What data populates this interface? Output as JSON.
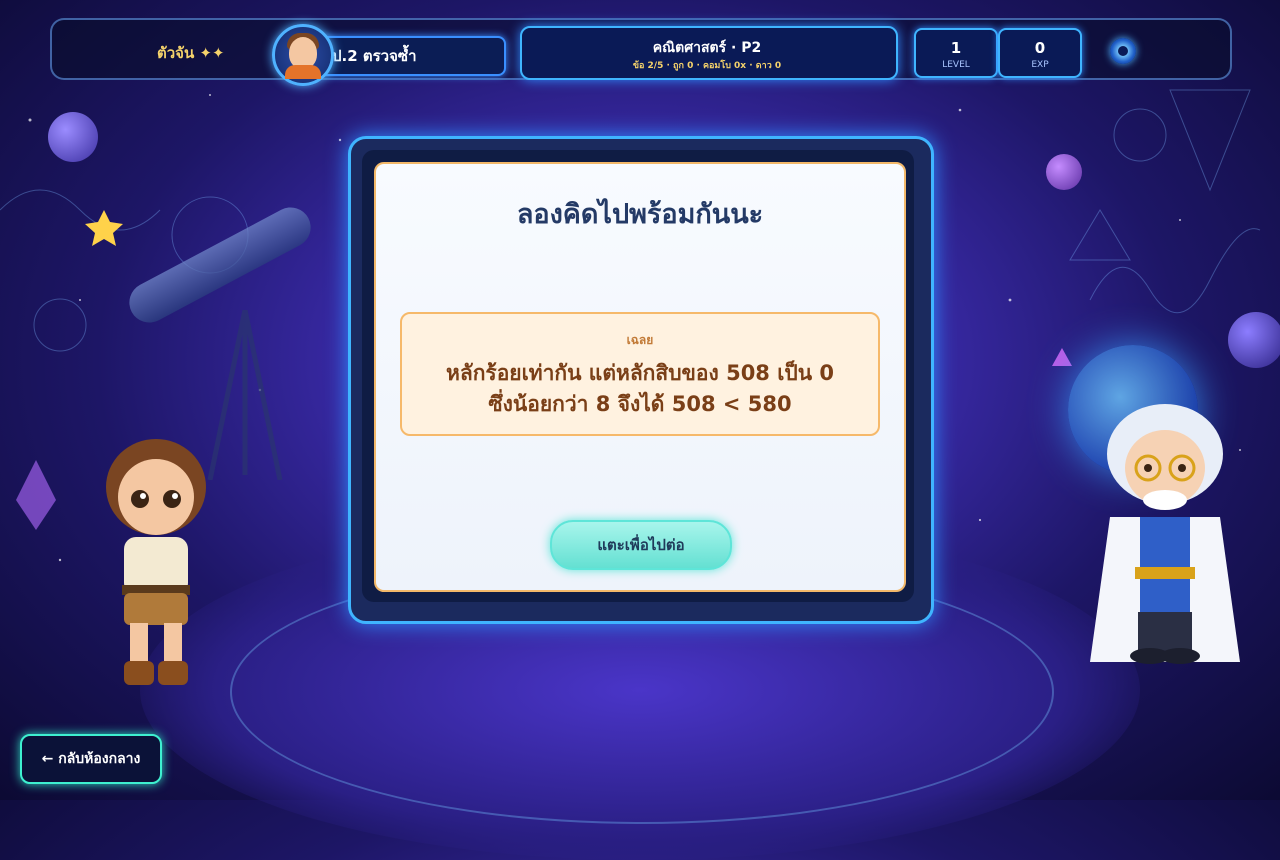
{
  "header": {
    "world_label": "ตัวจัน ✦✦",
    "grade_label": "ป.2 ตรวจซ้ำ",
    "subject_title": "คณิตศาสตร์ · P2",
    "subject_subtitle": "ข้อ 2/5 · ถูก 0 · คอมโบ 0x · ดาว 0",
    "level": {
      "value": "1",
      "label": "LEVEL"
    },
    "exp": {
      "value": "0",
      "label": "EXP"
    }
  },
  "modal": {
    "title": "ลองคิดไปพร้อมกันนะ",
    "answer_label": "เฉลย",
    "answer_line1": "หลักร้อยเท่ากัน แต่หลักสิบของ 508 เป็น 0",
    "answer_line2": "ซึ่งน้อยกว่า 8 จึงได้ 508 < 580",
    "continue_label": "แตะเพื่อไปต่อ"
  },
  "footer": {
    "back_label": "← กลับห้องกลาง"
  },
  "icons": {
    "avatar": "student-avatar",
    "settings": "settings-orb-icon"
  },
  "colors": {
    "accent": "#3fb5ff",
    "gold": "#f5d36b",
    "answer_border": "#f6b96a",
    "continue": "#64e0d2",
    "back_border": "#3ef0d0"
  }
}
